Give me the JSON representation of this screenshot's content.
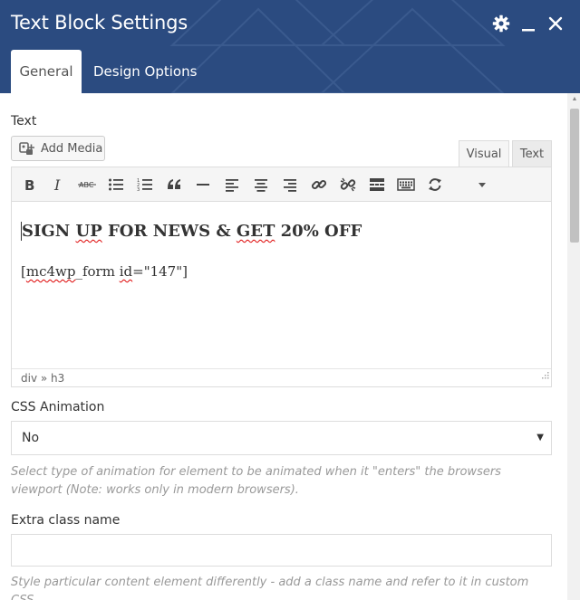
{
  "window": {
    "title": "Text Block Settings",
    "icons": [
      "gear-icon",
      "minimize-icon",
      "close-icon"
    ]
  },
  "tabs": [
    {
      "label": "General",
      "active": true
    },
    {
      "label": "Design Options",
      "active": false
    }
  ],
  "text_field": {
    "label": "Text",
    "add_media_label": "Add Media",
    "mode_visual": "Visual",
    "mode_text": "Text",
    "toolbar": [
      "bold-icon",
      "italic-icon",
      "strikethrough-icon",
      "bullet-list-icon",
      "numbered-list-icon",
      "blockquote-icon",
      "horizontal-rule-icon",
      "align-left-icon",
      "align-center-icon",
      "align-right-icon",
      "link-icon",
      "unlink-icon",
      "read-more-icon",
      "keyboard-icon",
      "refresh-icon",
      "dropdown-icon"
    ],
    "heading_parts": [
      "SIGN ",
      "UP",
      " FOR NEWS & ",
      "GET",
      " 20% OFF"
    ],
    "shortcode_parts": [
      "[",
      "mc4wp",
      "_form ",
      "id",
      "=\"147\"]"
    ],
    "status_path": "div » h3"
  },
  "css_animation": {
    "label": "CSS Animation",
    "value": "No",
    "help": "Select type of animation for element to be animated when it \"enters\" the browsers viewport (Note: works only in modern browsers)."
  },
  "extra_class": {
    "label": "Extra class name",
    "value": "",
    "help": "Style particular content element differently - add a class name and refer to it in custom CSS."
  },
  "colors": {
    "header_bg": "#2b4b80",
    "header_text": "#ffffff",
    "help_text": "#999999"
  }
}
